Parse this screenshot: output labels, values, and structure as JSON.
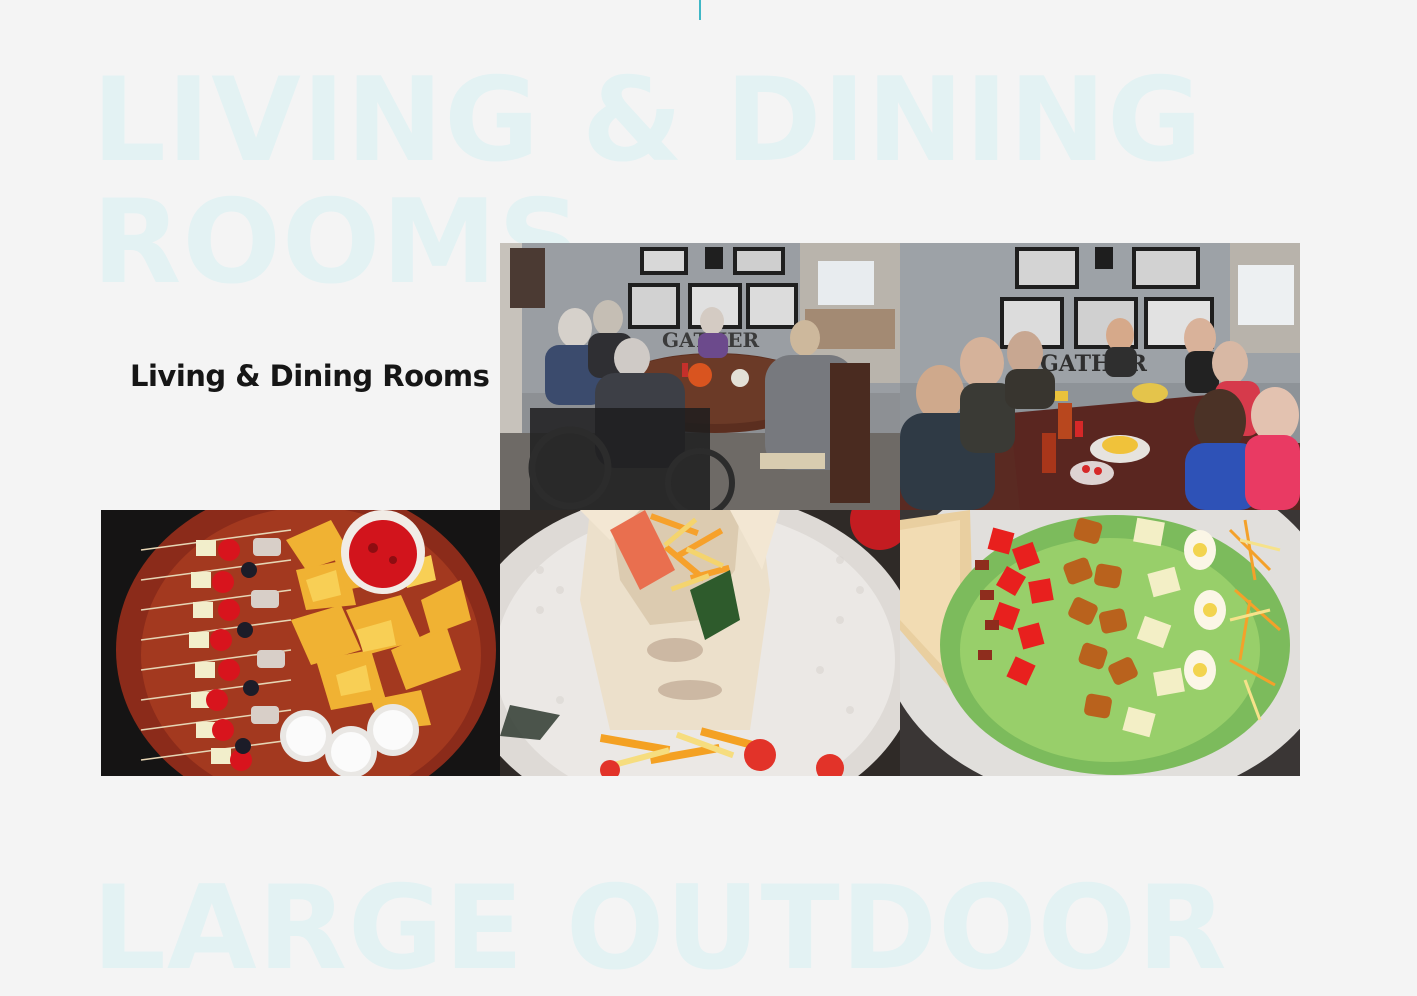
{
  "background_titles": {
    "living_dining": [
      "LIVING & DINING",
      "ROOMS"
    ],
    "outdoor": [
      "LARGE OUTDOOR"
    ]
  },
  "section": {
    "heading": "Living & Dining Rooms"
  },
  "photos": [
    {
      "id": "dining-residents",
      "icon": "photo-residents-dining",
      "sign_text": "GATHER"
    },
    {
      "id": "dining-group",
      "icon": "photo-group-dining",
      "sign_text": "GATHER"
    },
    {
      "id": "kabob-platter",
      "icon": "photo-kabob-chips-platter"
    },
    {
      "id": "wrap",
      "icon": "photo-tortilla-wrap"
    },
    {
      "id": "salad",
      "icon": "photo-cobb-salad"
    }
  ],
  "colors": {
    "page_bg": "#f4f4f4",
    "watermark_text": "#e3f2f3",
    "heading_text": "#161616",
    "accent": "#3fb7c6"
  }
}
